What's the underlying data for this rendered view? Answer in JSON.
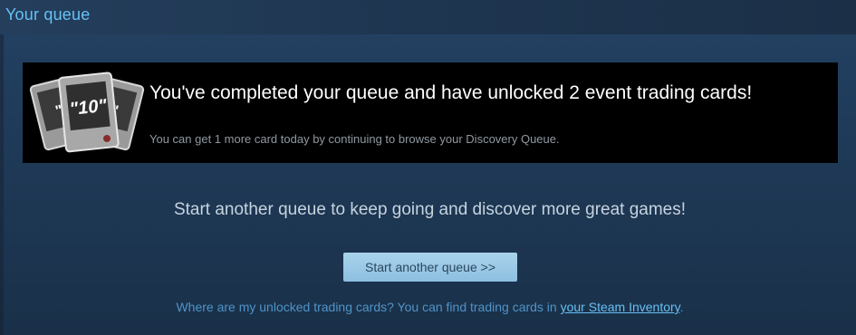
{
  "header": {
    "title": "Your queue"
  },
  "banner": {
    "title": "You've completed your queue and have unlocked 2 event trading cards!",
    "subtitle": "You can get 1 more card today by continuing to browse your Discovery Queue.",
    "cards_icon_text": "10"
  },
  "main": {
    "prompt": "Start another queue to keep going and discover more great games!",
    "start_button_label": "Start another queue >>",
    "footer_text": "Where are my unlocked trading cards? You can find trading cards in ",
    "footer_link": "your Steam Inventory",
    "footer_end": "."
  },
  "colors": {
    "accent": "#66c0f4",
    "background": "#1b2838",
    "button": "#8ebfe0"
  }
}
